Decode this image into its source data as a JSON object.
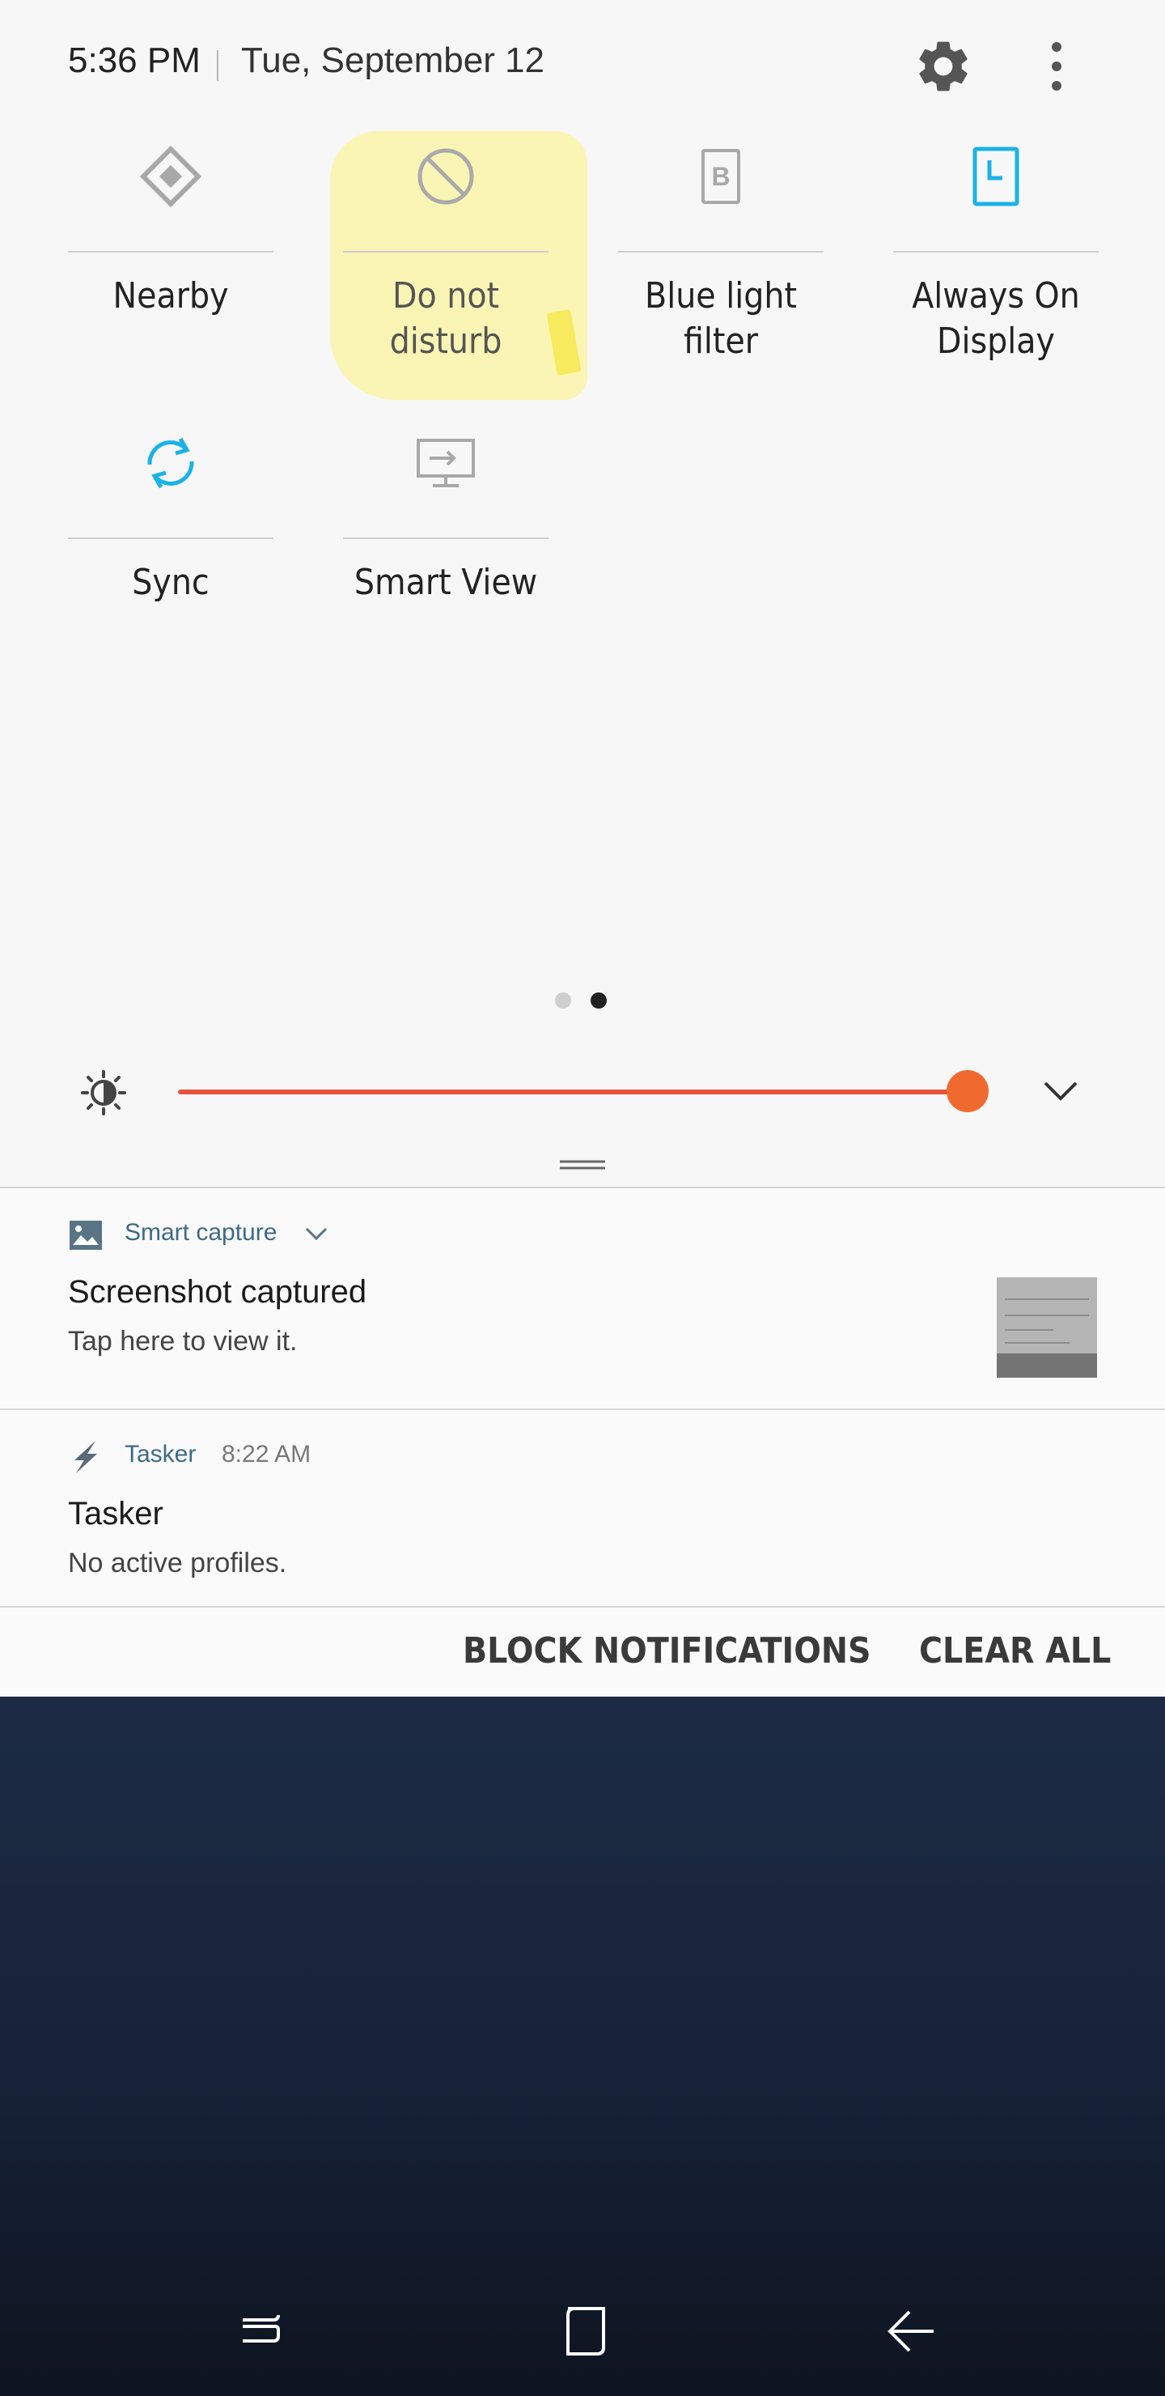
{
  "status": {
    "time": "5:36 PM",
    "date": "Tue, September 12"
  },
  "icons": {
    "settings": "gear-icon",
    "more": "more-vertical-icon"
  },
  "quick_settings": {
    "tiles": [
      {
        "label": "Nearby",
        "icon": "nearby-icon",
        "active": false
      },
      {
        "label": "Do not\ndisturb",
        "icon": "do-not-disturb-icon",
        "active": false,
        "highlighted": true
      },
      {
        "label": "Blue light\nfilter",
        "icon": "blue-light-filter-icon",
        "active": false
      },
      {
        "label": "Always On\nDisplay",
        "icon": "always-on-display-icon",
        "active": true
      },
      {
        "label": "Sync",
        "icon": "sync-icon",
        "active": true
      },
      {
        "label": "Smart View",
        "icon": "smart-view-icon",
        "active": false
      }
    ],
    "page_indicator": {
      "pages": 2,
      "current": 2
    }
  },
  "brightness": {
    "level": 1.0,
    "icon": "brightness-icon",
    "expand_icon": "chevron-down-icon"
  },
  "notifications": [
    {
      "app": "Smart capture",
      "time": "",
      "title": "Screenshot captured",
      "body": "Tap here to view it.",
      "icon": "image-icon"
    },
    {
      "app": "Tasker",
      "time": "8:22 AM",
      "title": "Tasker",
      "body": "No active profiles.",
      "icon": "tasker-bolt-icon"
    }
  ],
  "actions": {
    "block": "BLOCK NOTIFICATIONS",
    "clear": "CLEAR ALL"
  },
  "colors": {
    "accent": "#1ab3e6",
    "slider": "#e8533f",
    "knob": "#f06a30",
    "highlight": "#fbf5b5"
  }
}
